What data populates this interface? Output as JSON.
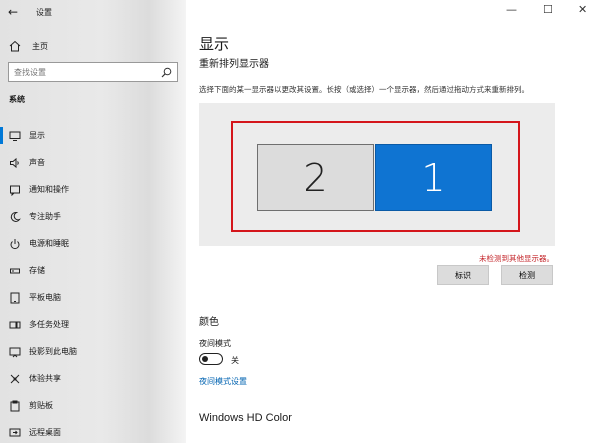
{
  "window": {
    "title": "设置",
    "back_icon": "←",
    "minimize_icon": "—",
    "maximize_icon": "☐",
    "close_icon": "✕"
  },
  "sidebar": {
    "home_label": "主页",
    "search_placeholder": "查找设置",
    "section_title": "系统",
    "items": [
      {
        "label": "显示",
        "icon": "monitor-icon",
        "active": true
      },
      {
        "label": "声音",
        "icon": "speaker-icon"
      },
      {
        "label": "通知和操作",
        "icon": "notification-icon"
      },
      {
        "label": "专注助手",
        "icon": "moon-icon"
      },
      {
        "label": "电源和睡眠",
        "icon": "power-icon"
      },
      {
        "label": "存储",
        "icon": "storage-icon"
      },
      {
        "label": "平板电脑",
        "icon": "tablet-icon"
      },
      {
        "label": "多任务处理",
        "icon": "multitask-icon"
      },
      {
        "label": "投影到此电脑",
        "icon": "project-icon"
      },
      {
        "label": "体验共享",
        "icon": "share-icon"
      },
      {
        "label": "剪贴板",
        "icon": "clipboard-icon"
      },
      {
        "label": "远程桌面",
        "icon": "remote-desktop-icon"
      }
    ]
  },
  "main": {
    "page_title": "显示",
    "subtitle": "重新排列显示器",
    "description": "选择下面的某一显示器以更改其设置。长按（或选择）一个显示器，然后通过拖动方式来重新排列。",
    "monitors": [
      {
        "label": "2",
        "selected": false
      },
      {
        "label": "1",
        "selected": true
      }
    ],
    "warning": "未检测到其他显示器。",
    "identify_button": "标识",
    "detect_button": "检测",
    "color_title": "颜色",
    "night_mode_label": "夜间模式",
    "night_mode_state": "关",
    "night_mode_link": "夜间模式设置",
    "hd_color_title": "Windows HD Color"
  },
  "colors": {
    "accent": "#0078d7",
    "selected_monitor": "#0f74d2",
    "highlight_box": "#d4151b",
    "warning_text": "#c4262b",
    "link": "#0063b1"
  }
}
